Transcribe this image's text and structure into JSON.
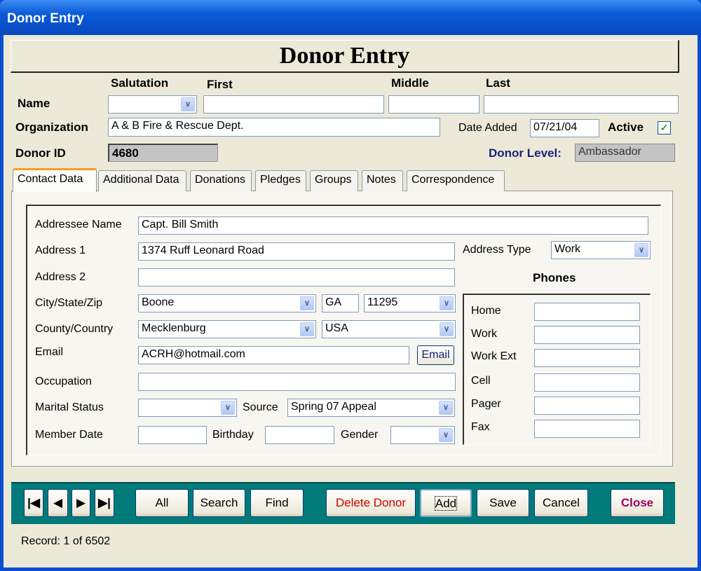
{
  "window": {
    "title": "Donor Entry"
  },
  "header": {
    "title": "Donor Entry"
  },
  "name": {
    "label": "Name",
    "salutation_label": "Salutation",
    "first_label": "First",
    "middle_label": "Middle",
    "last_label": "Last",
    "salutation": "",
    "first": "",
    "middle": "",
    "last": ""
  },
  "organization": {
    "label": "Organization",
    "value": "A & B Fire & Rescue Dept."
  },
  "date_added": {
    "label": "Date Added",
    "value": "07/21/04"
  },
  "active": {
    "label": "Active",
    "checked": true
  },
  "donor_id": {
    "label": "Donor ID",
    "value": "4680"
  },
  "donor_level": {
    "label": "Donor Level:",
    "value": "Ambassador"
  },
  "tabs": [
    {
      "label": "Contact Data",
      "active": true
    },
    {
      "label": "Additional Data"
    },
    {
      "label": "Donations"
    },
    {
      "label": "Pledges"
    },
    {
      "label": "Groups"
    },
    {
      "label": "Notes"
    },
    {
      "label": "Correspondence"
    }
  ],
  "contact": {
    "addressee_label": "Addressee Name",
    "addressee": "Capt. Bill Smith",
    "address1_label": "Address 1",
    "address1": "1374 Ruff Leonard Road",
    "address_type_label": "Address Type",
    "address_type": "Work",
    "address2_label": "Address 2",
    "address2": "",
    "city_label": "City/State/Zip",
    "city": "Boone",
    "state": "GA",
    "zip": "11295",
    "county_label": "County/Country",
    "county": "Mecklenburg",
    "country": "USA",
    "email_label": "Email",
    "email": "ACRH@hotmail.com",
    "email_button": "Email",
    "occupation_label": "Occupation",
    "occupation": "",
    "marital_label": "Marital Status",
    "marital": "",
    "source_label": "Source",
    "source": "Spring 07 Appeal",
    "member_date_label": "Member Date",
    "member_date": "",
    "birthday_label": "Birthday",
    "birthday": "",
    "gender_label": "Gender",
    "gender": ""
  },
  "phones": {
    "title": "Phones",
    "items": [
      {
        "label": "Home",
        "value": ""
      },
      {
        "label": "Work",
        "value": ""
      },
      {
        "label": "Work Ext",
        "value": ""
      },
      {
        "label": "Cell",
        "value": ""
      },
      {
        "label": "Pager",
        "value": ""
      },
      {
        "label": "Fax",
        "value": ""
      }
    ]
  },
  "toolbar": {
    "all": "All",
    "search": "Search",
    "find": "Find",
    "delete": "Delete Donor",
    "add": "Add",
    "save": "Save",
    "cancel": "Cancel",
    "close": "Close",
    "delete_color": "#cc0000",
    "close_color": "#990066",
    "bar_color": "#007b7a"
  },
  "status": {
    "record": "Record: 1 of 6502"
  }
}
